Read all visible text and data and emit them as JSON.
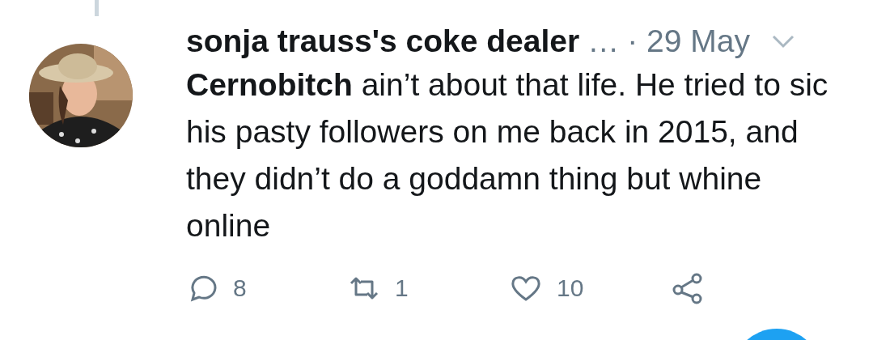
{
  "tweet": {
    "author_name": "sonja trauss's coke dealer",
    "handle_truncated": "…",
    "time": "· 29 May",
    "text": "**Cernobitch** ain’t about that life. He tried to sic his pasty followers on me back in 2015, and they didn’t do a goddamn thing but whine online",
    "actions": [
      {
        "kind": "reply",
        "count": "8"
      },
      {
        "kind": "retweet",
        "count": "1"
      },
      {
        "kind": "like",
        "count": "10"
      },
      {
        "kind": "share"
      }
    ]
  }
}
